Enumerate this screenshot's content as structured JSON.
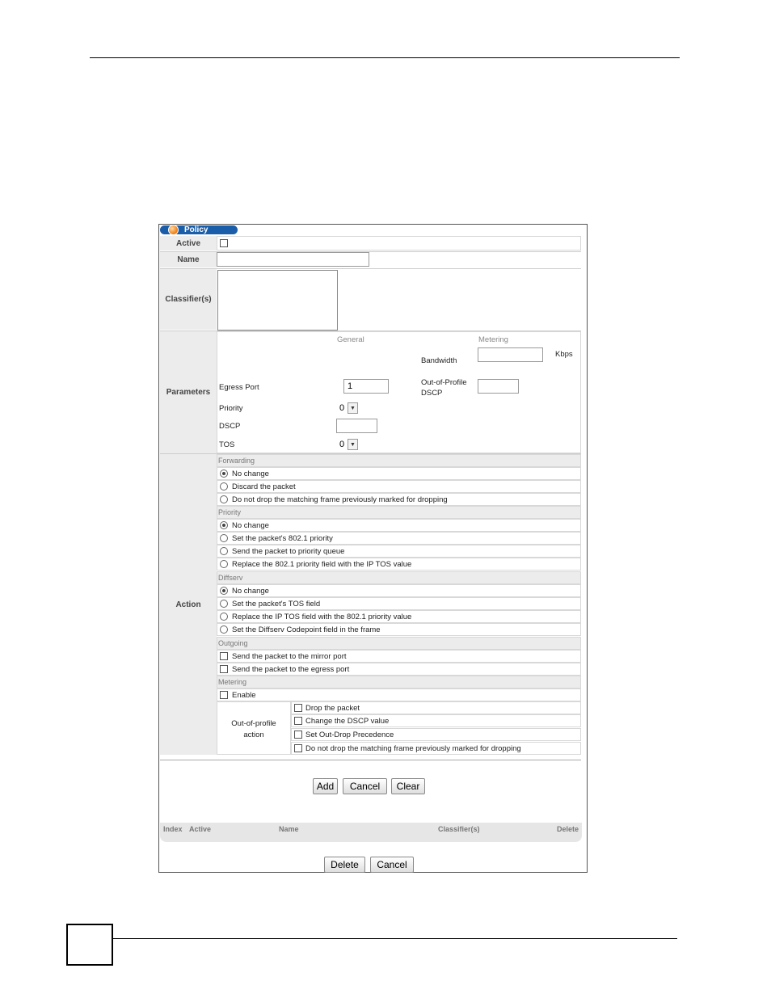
{
  "window": {
    "title": "Policy"
  },
  "fields": {
    "active_label": "Active",
    "active_checked": false,
    "name_label": "Name",
    "name_value": "",
    "classifiers_label": "Classifier(s)",
    "classifiers_value": ""
  },
  "parameters": {
    "label": "Parameters",
    "general_header": "General",
    "metering_header": "Metering",
    "bandwidth_label": "Bandwidth",
    "bandwidth_value": "",
    "bandwidth_unit": "Kbps",
    "egress_port_label": "Egress Port",
    "egress_port_value": "1",
    "oop_dscp_label_1": "Out-of-Profile",
    "oop_dscp_label_2": "DSCP",
    "oop_dscp_value": "",
    "priority_label": "Priority",
    "priority_value": "0",
    "dscp_label": "DSCP",
    "dscp_value": "",
    "tos_label": "TOS",
    "tos_value": "0"
  },
  "action": {
    "label": "Action",
    "forwarding": {
      "header": "Forwarding",
      "options": [
        "No change",
        "Discard the packet",
        "Do not drop the matching frame previously marked for dropping"
      ],
      "selected": 0
    },
    "priority": {
      "header": "Priority",
      "options": [
        "No change",
        "Set the packet's 802.1 priority",
        "Send the packet to priority queue",
        "Replace the 802.1 priority field with the IP TOS value"
      ],
      "selected": 0
    },
    "diffserv": {
      "header": "Diffserv",
      "options": [
        "No change",
        "Set the packet's TOS field",
        "Replace the IP TOS field with the 802.1 priority value",
        "Set the Diffserv Codepoint field in the frame"
      ],
      "selected": 0
    },
    "outgoing": {
      "header": "Outgoing",
      "options": [
        "Send the packet to the mirror port",
        "Send the packet to the egress port"
      ]
    },
    "metering": {
      "header": "Metering",
      "enable_label": "Enable",
      "oop_label_1": "Out-of-profile",
      "oop_label_2": "action",
      "oop_options": [
        "Drop the packet",
        "Change the DSCP value",
        "Set Out-Drop Precedence",
        "Do not drop the matching frame previously marked for dropping"
      ]
    }
  },
  "buttons": {
    "add": "Add",
    "cancel": "Cancel",
    "clear": "Clear",
    "delete": "Delete",
    "cancel2": "Cancel"
  },
  "list": {
    "columns": [
      "Index",
      "Active",
      "Name",
      "Classifier(s)",
      "Delete"
    ],
    "rows": []
  }
}
